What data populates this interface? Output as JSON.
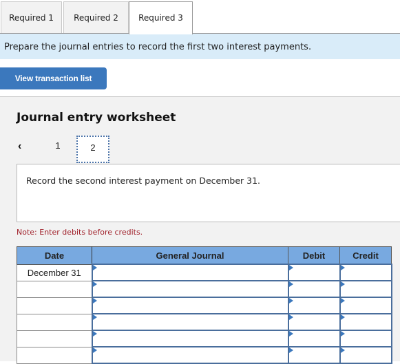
{
  "tabs": [
    {
      "label": "Required 1",
      "active": false
    },
    {
      "label": "Required 2",
      "active": false
    },
    {
      "label": "Required 3",
      "active": true
    }
  ],
  "banner": "Prepare the journal entries to record the first two interest payments.",
  "view_transaction_list": "View transaction list",
  "worksheet": {
    "title": "Journal entry worksheet",
    "pager": {
      "prev_icon": "chevron-left-icon",
      "pages": [
        "1",
        "2"
      ],
      "current": "2"
    },
    "instruction": "Record the second interest payment on December 31.",
    "note": "Note: Enter debits before credits."
  },
  "table": {
    "headers": [
      "Date",
      "General Journal",
      "Debit",
      "Credit"
    ],
    "rows": [
      {
        "date": "December 31",
        "account": "",
        "debit": "",
        "credit": ""
      },
      {
        "date": "",
        "account": "",
        "debit": "",
        "credit": ""
      },
      {
        "date": "",
        "account": "",
        "debit": "",
        "credit": ""
      },
      {
        "date": "",
        "account": "",
        "debit": "",
        "credit": ""
      },
      {
        "date": "",
        "account": "",
        "debit": "",
        "credit": ""
      },
      {
        "date": "",
        "account": "",
        "debit": "",
        "credit": ""
      }
    ]
  },
  "colors": {
    "accent": "#3b78bd",
    "header": "#78a9e0",
    "banner": "#d9ecf9",
    "note": "#a0202a"
  }
}
